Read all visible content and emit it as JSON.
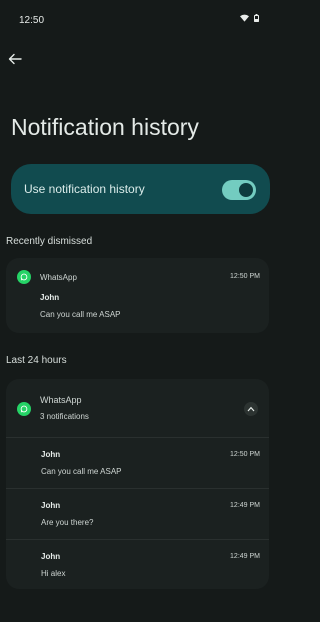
{
  "status_bar": {
    "time": "12:50"
  },
  "page": {
    "title": "Notification history"
  },
  "toggle": {
    "label": "Use notification history",
    "enabled": true
  },
  "recently_dismissed": {
    "section_title": "Recently dismissed",
    "app_name": "WhatsApp",
    "time": "12:50 PM",
    "sender": "John",
    "message": "Can you call me ASAP"
  },
  "last_24_hours": {
    "section_title": "Last 24 hours",
    "app_name": "WhatsApp",
    "count_label": "3 notifications",
    "items": [
      {
        "sender": "John",
        "time": "12:50 PM",
        "message": "Can you call me ASAP"
      },
      {
        "sender": "John",
        "time": "12:49 PM",
        "message": "Are you there?"
      },
      {
        "sender": "John",
        "time": "12:49 PM",
        "message": "Hi alex"
      }
    ]
  },
  "colors": {
    "background": "#151a19",
    "toggle_card": "#114b4f",
    "switch_on": "#73ccc0",
    "whatsapp": "#25d366"
  }
}
